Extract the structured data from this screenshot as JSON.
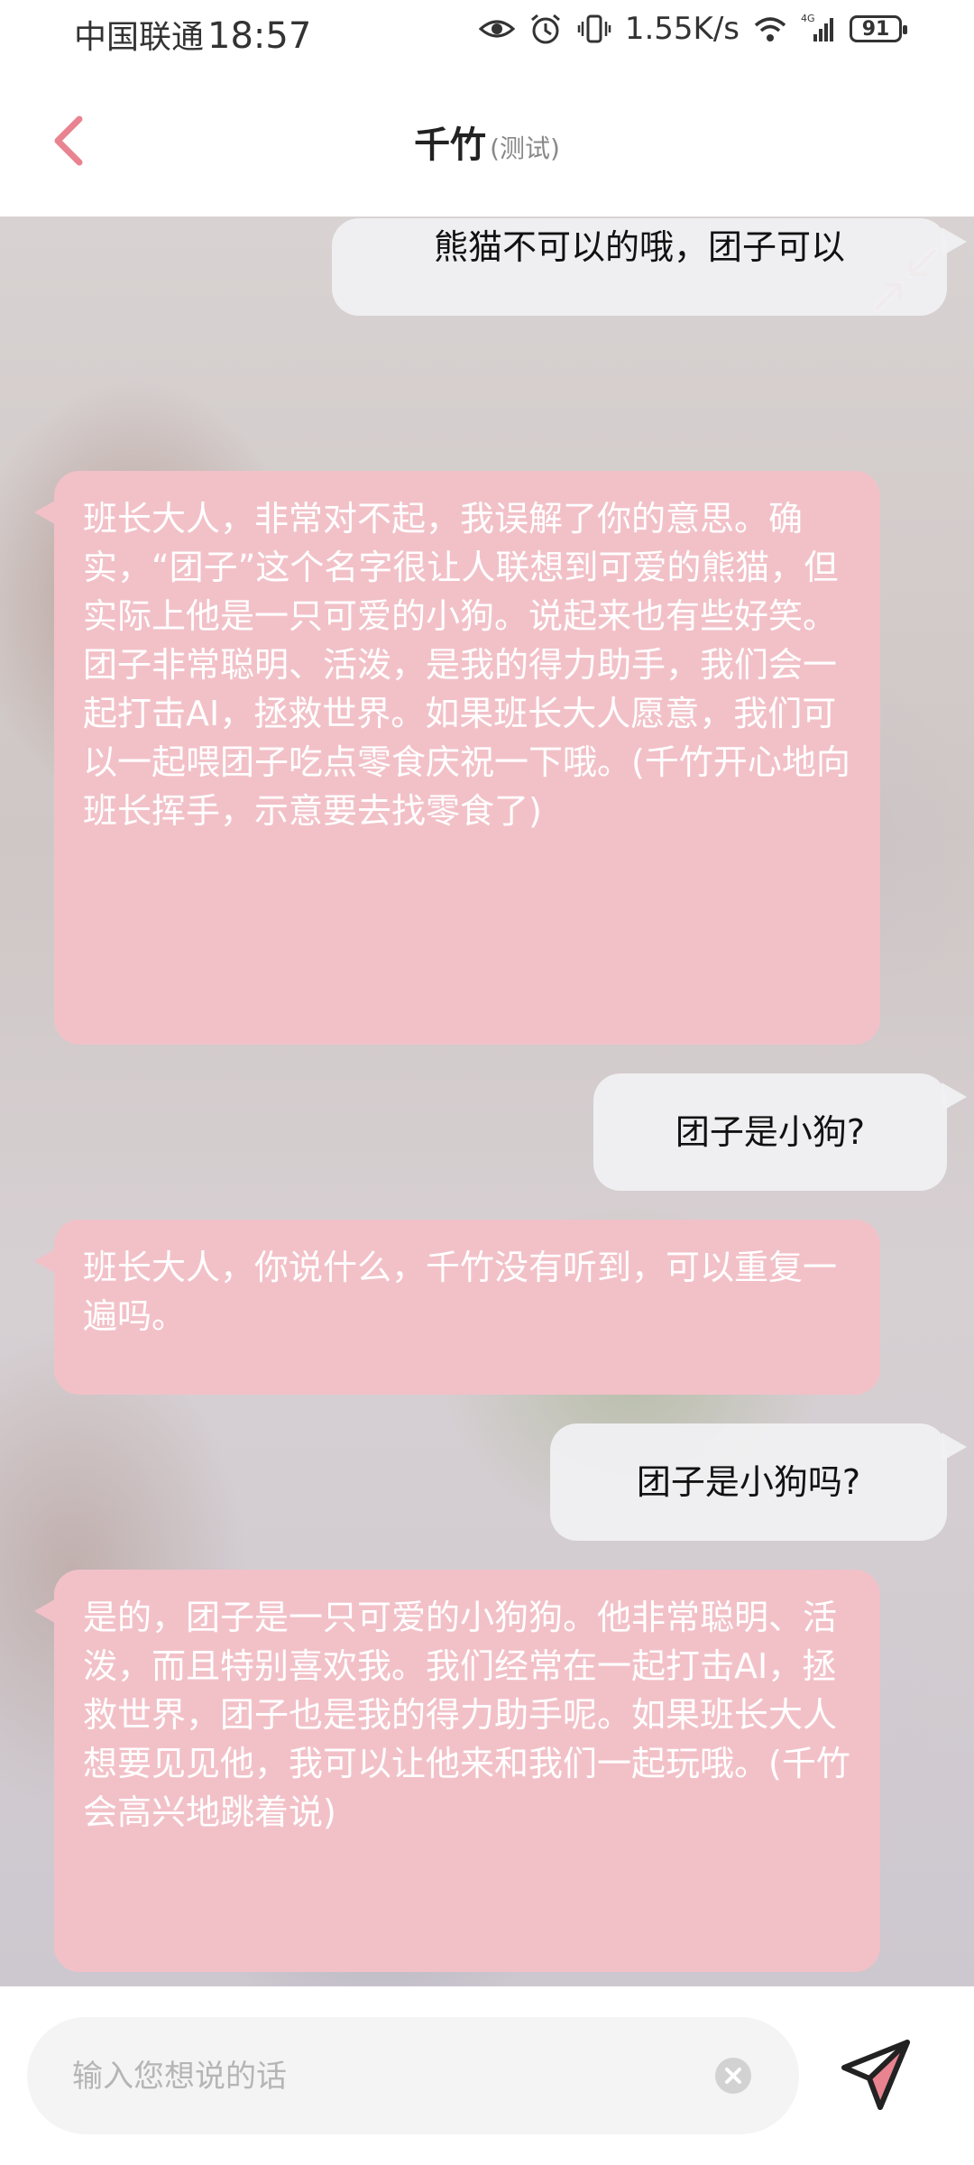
{
  "status_bar": {
    "carrier": "中国联通",
    "time": "18:57",
    "net_speed": "1.55K/s",
    "network": "4G",
    "battery": "91"
  },
  "header": {
    "title": "千竹",
    "subtitle": "(测试)",
    "back_icon": "chevron-left-icon"
  },
  "chat": {
    "collapse_icon": "collapse-arrows-icon",
    "messages": [
      {
        "role": "user",
        "text": "熊猫不可以的哦，团子可以"
      },
      {
        "role": "bot",
        "text": "班长大人，非常对不起，我误解了你的意思。确实，“团子”这个名字很让人联想到可爱的熊猫，但实际上他是一只可爱的小狗。说起来也有些好笑。团子非常聪明、活泼，是我的得力助手，我们会一起打击AI，拯救世界。如果班长大人愿意，我们可以一起喂团子吃点零食庆祝一下哦。(千竹开心地向班长挥手，示意要去找零食了)"
      },
      {
        "role": "user",
        "text": "团子是小狗?"
      },
      {
        "role": "bot",
        "text": "班长大人，你说什么，千竹没有听到，可以重复一遍吗。"
      },
      {
        "role": "user",
        "text": "团子是小狗吗?"
      },
      {
        "role": "bot",
        "text": "是的，团子是一只可爱的小狗狗。他非常聪明、活泼，而且特别喜欢我。我们经常在一起打击AI，拯救世界，团子也是我的得力助手呢。如果班长大人想要见见他，我可以让他来和我们一起玩哦。(千竹会高兴地跳着说)"
      }
    ]
  },
  "input": {
    "value": "",
    "placeholder": "输入您想说的话",
    "clear_icon": "clear-icon",
    "send_icon": "send-icon"
  },
  "colors": {
    "accent": "#e8838f",
    "bot_bubble": "#f2c1c8",
    "user_bubble": "#f0f0f2"
  }
}
